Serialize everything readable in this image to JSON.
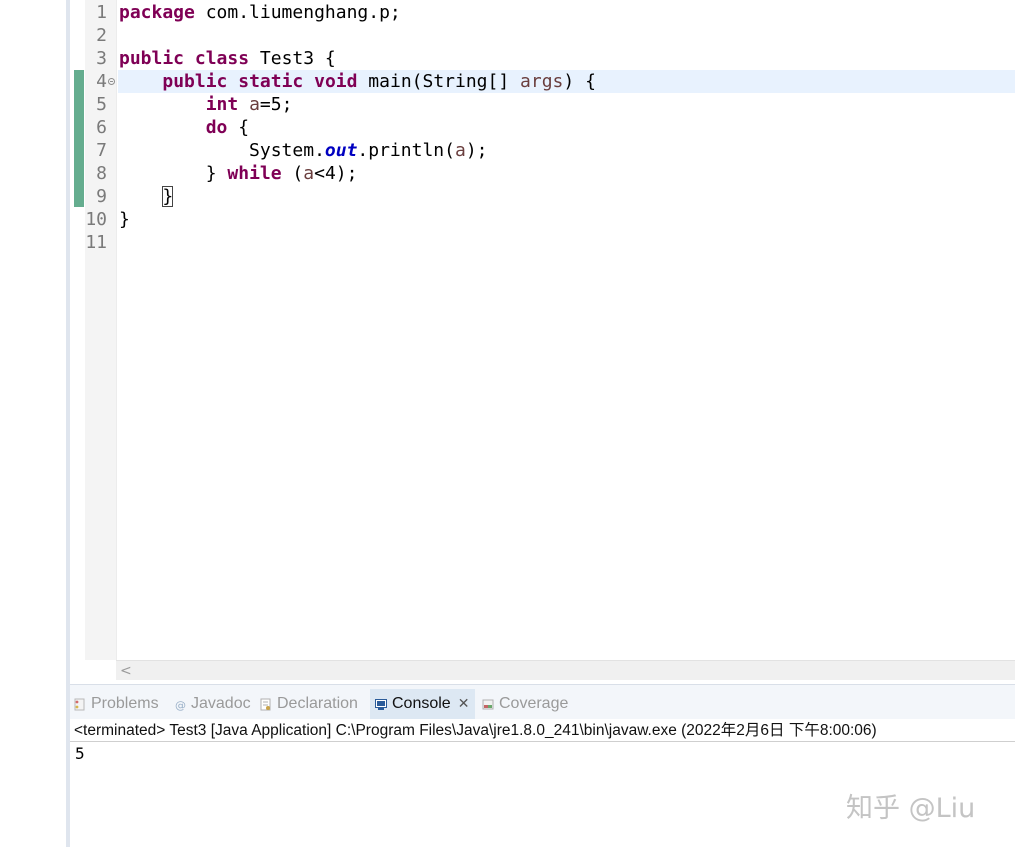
{
  "editor": {
    "line_numbers": [
      "1",
      "2",
      "3",
      "4",
      "5",
      "6",
      "7",
      "8",
      "9",
      "10",
      "11"
    ],
    "lines": {
      "l1": {
        "kw": "package",
        "rest": " com.liumenghang.p;"
      },
      "l3": {
        "kw1": "public",
        "kw2": "class",
        "rest": " Test3 {"
      },
      "l4": {
        "kw1": "public",
        "kw2": "static",
        "kw3": "void",
        "rest1": " main(String[] ",
        "var": "args",
        "rest2": ") {"
      },
      "l5": {
        "kw": "int",
        "var": "a",
        "rest": "=5;"
      },
      "l6": {
        "kw": "do",
        "rest": " {"
      },
      "l7": {
        "p1": "System.",
        "fld": "out",
        "p2": ".println(",
        "var": "a",
        "p3": ");"
      },
      "l8": {
        "p1": "} ",
        "kw": "while",
        "p2": " (",
        "var": "a",
        "p3": "<4);"
      },
      "l9": {
        "brace": "}"
      },
      "l10": {
        "text": "}"
      }
    },
    "hscroll_icon": "chevron-left-icon",
    "hscroll_glyph": "<"
  },
  "panel": {
    "tabs": [
      {
        "label": "Problems",
        "icon": "problems-icon",
        "active": false
      },
      {
        "label": "Javadoc",
        "icon": "at-sign-icon",
        "active": false
      },
      {
        "label": "Declaration",
        "icon": "declaration-icon",
        "active": false
      },
      {
        "label": "Console",
        "icon": "console-icon",
        "active": true,
        "close_glyph": "✕"
      },
      {
        "label": "Coverage",
        "icon": "coverage-icon",
        "active": false
      }
    ],
    "terminated_line": "<terminated> Test3 [Java Application] C:\\Program Files\\Java\\jre1.8.0_241\\bin\\javaw.exe (2022年2月6日 下午8:00:06)",
    "output": "5"
  },
  "watermark": "知乎 @Liu",
  "colors": {
    "keyword": "#7f0055",
    "variable": "#6a3e3e",
    "field": "#0000c0",
    "current_line": "#e8f2fe",
    "change_bar": "#65ad8f"
  }
}
